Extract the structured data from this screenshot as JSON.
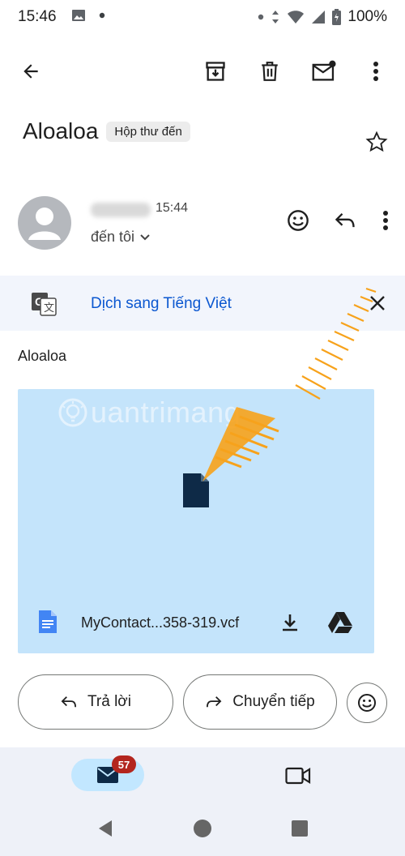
{
  "status_bar": {
    "time": "15:46",
    "battery_percent": "100%"
  },
  "toolbar": {
    "icons": [
      "back-arrow-icon",
      "archive-icon",
      "delete-icon",
      "mark-unread-icon",
      "more-vert-icon"
    ]
  },
  "email": {
    "subject": "Aloaloa",
    "label": "Hộp thư đến",
    "sender_time": "15:44",
    "recipient": "đến tôi",
    "body": "Aloaloa"
  },
  "translate": {
    "link_text": "Dịch sang Tiếng Việt"
  },
  "attachment": {
    "filename": "MyContact...358-319.vcf",
    "watermark": "uantrimang"
  },
  "actions": {
    "reply_label": "Trả lời",
    "forward_label": "Chuyển tiếp"
  },
  "bottom_nav": {
    "mail_badge": "57"
  },
  "colors": {
    "accent_link": "#0b57d0",
    "attachment_bg": "#c4e4fb",
    "nav_active": "#c2e7ff",
    "badge": "#b3261e",
    "annotation_arrow": "#f7a21b"
  }
}
